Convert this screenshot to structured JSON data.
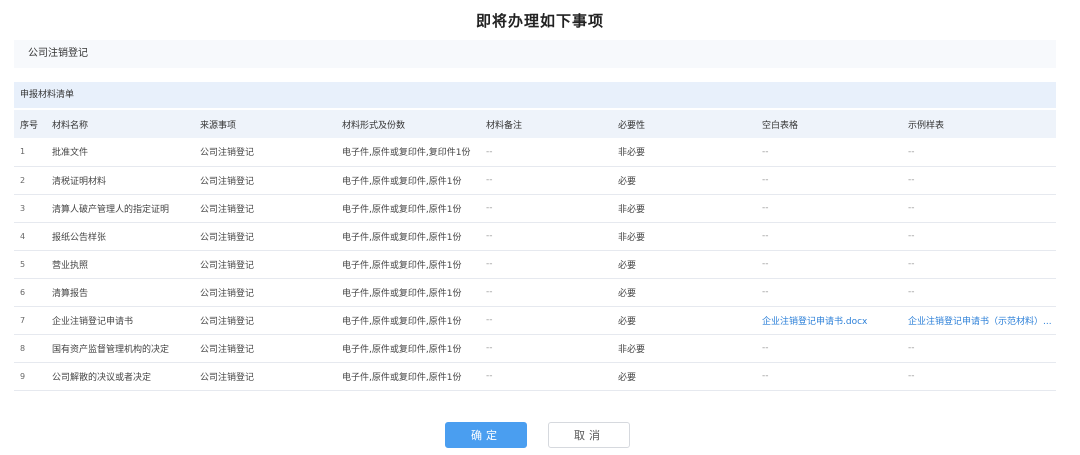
{
  "dialog": {
    "title": "即将办理如下事项"
  },
  "matter": {
    "name": "公司注销登记"
  },
  "section": {
    "title": "申报材料清单"
  },
  "table": {
    "headers": [
      "序号",
      "材料名称",
      "来源事项",
      "材料形式及份数",
      "材料备注",
      "必要性",
      "空白表格",
      "示例样表"
    ],
    "rows": [
      [
        "1",
        "批准文件",
        "公司注销登记",
        "电子件,原件或复印件,复印件1份",
        "--",
        "非必要",
        "--",
        "--"
      ],
      [
        "2",
        "清税证明材料",
        "公司注销登记",
        "电子件,原件或复印件,原件1份",
        "--",
        "必要",
        "--",
        "--"
      ],
      [
        "3",
        "清算人破产管理人的指定证明",
        "公司注销登记",
        "电子件,原件或复印件,原件1份",
        "--",
        "非必要",
        "--",
        "--"
      ],
      [
        "4",
        "报纸公告样张",
        "公司注销登记",
        "电子件,原件或复印件,原件1份",
        "--",
        "非必要",
        "--",
        "--"
      ],
      [
        "5",
        "营业执照",
        "公司注销登记",
        "电子件,原件或复印件,原件1份",
        "--",
        "必要",
        "--",
        "--"
      ],
      [
        "6",
        "清算报告",
        "公司注销登记",
        "电子件,原件或复印件,原件1份",
        "--",
        "必要",
        "--",
        "--"
      ],
      [
        "7",
        "企业注销登记申请书",
        "公司注销登记",
        "电子件,原件或复印件,原件1份",
        "--",
        "必要",
        "企业注销登记申请书.docx",
        "企业注销登记申请书（示范材料）..."
      ],
      [
        "8",
        "国有资产监督管理机构的决定",
        "公司注销登记",
        "电子件,原件或复印件,原件1份",
        "--",
        "非必要",
        "--",
        "--"
      ],
      [
        "9",
        "公司解散的决议或者决定",
        "公司注销登记",
        "电子件,原件或复印件,原件1份",
        "--",
        "必要",
        "--",
        "--"
      ]
    ]
  },
  "buttons": {
    "confirm": "确定",
    "cancel": "取消"
  },
  "colors": {
    "primary": "#4a9ef0",
    "link": "#2b7fd8",
    "header_bg": "#e8f0fb"
  }
}
